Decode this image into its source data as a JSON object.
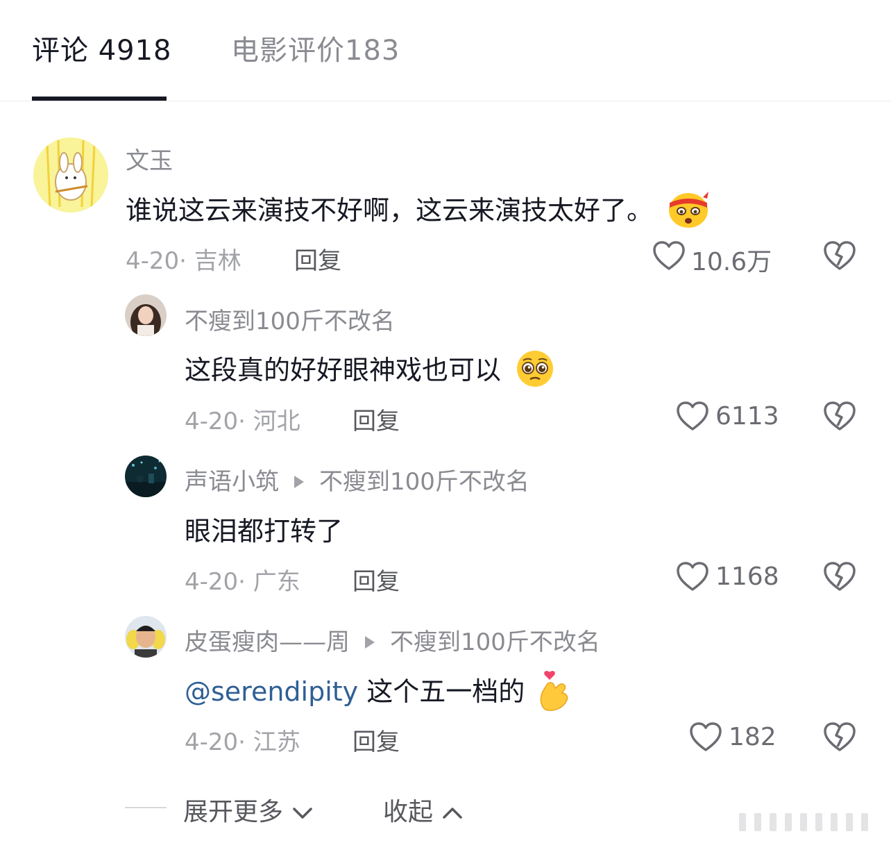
{
  "tabs": [
    {
      "label": "评论 4918",
      "active": true
    },
    {
      "label": "电影评价183",
      "active": false
    }
  ],
  "comments": [
    {
      "user": "文玉",
      "reply_to": "",
      "text": "谁说这云来演技不好啊，这云来演技太好了。",
      "emoji": "angry-headband-emoji",
      "date_location": "4-20· 吉林",
      "reply_label": "回复",
      "likes": "10.6万"
    },
    {
      "user": "不瘦到100斤不改名",
      "reply_to": "",
      "text": "这段真的好好眼神戏也可以",
      "emoji": "pleading-face-emoji",
      "date_location": "4-20· 河北",
      "reply_label": "回复",
      "likes": "6113"
    },
    {
      "user": "声语小筑",
      "reply_to": "不瘦到100斤不改名",
      "text": "眼泪都打转了",
      "emoji": "",
      "date_location": "4-20· 广东",
      "reply_label": "回复",
      "likes": "1168"
    },
    {
      "user": "皮蛋瘦肉——周",
      "reply_to": "不瘦到100斤不改名",
      "mention": "@serendipity",
      "text": " 这个五一档的",
      "emoji": "finger-heart-emoji",
      "date_location": "4-20· 江苏",
      "reply_label": "回复",
      "likes": "182"
    }
  ],
  "footer": {
    "expand_label": "展开更多",
    "collapse_label": "收起"
  }
}
